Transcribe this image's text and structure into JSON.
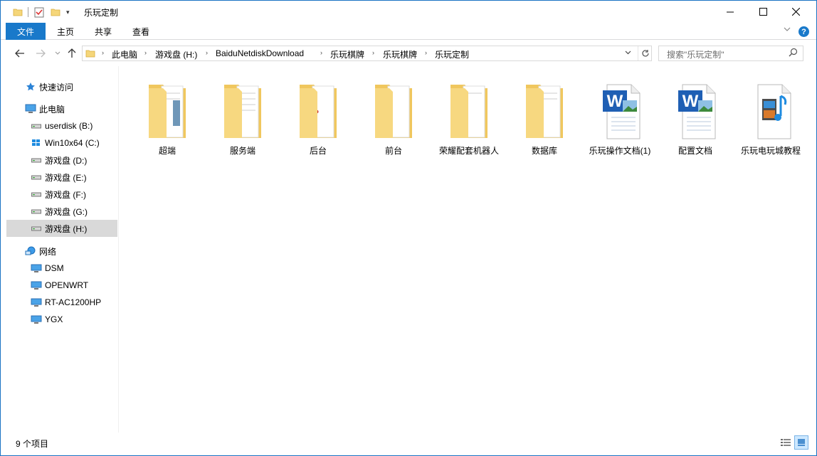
{
  "window": {
    "title": "乐玩定制"
  },
  "ribbon": {
    "tabs": [
      {
        "label": "文件",
        "active": true
      },
      {
        "label": "主页"
      },
      {
        "label": "共享"
      },
      {
        "label": "查看"
      }
    ],
    "help_label": "?"
  },
  "address": {
    "crumbs": [
      "此电脑",
      "游戏盘 (H:)",
      "BaiduNetdiskDownload",
      "乐玩棋牌",
      "乐玩棋牌",
      "乐玩定制"
    ]
  },
  "search": {
    "placeholder": "搜索\"乐玩定制\""
  },
  "sidebar": {
    "items": [
      {
        "label": "快速访问",
        "icon": "star-icon",
        "level": 0
      },
      {
        "label": "此电脑",
        "icon": "pc-icon",
        "level": 0
      },
      {
        "label": "userdisk (B:)",
        "icon": "drive-icon",
        "level": 1
      },
      {
        "label": "Win10x64 (C:)",
        "icon": "windows-drive-icon",
        "level": 1
      },
      {
        "label": "游戏盘 (D:)",
        "icon": "drive-icon",
        "level": 1
      },
      {
        "label": "游戏盘 (E:)",
        "icon": "drive-icon",
        "level": 1
      },
      {
        "label": "游戏盘 (F:)",
        "icon": "drive-icon",
        "level": 1
      },
      {
        "label": "游戏盘 (G:)",
        "icon": "drive-icon",
        "level": 1
      },
      {
        "label": "游戏盘 (H:)",
        "icon": "drive-icon",
        "level": 1,
        "selected": true
      },
      {
        "label": "网络",
        "icon": "network-icon",
        "level": 0
      },
      {
        "label": "DSM",
        "icon": "computer-icon",
        "level": 1
      },
      {
        "label": "OPENWRT",
        "icon": "computer-icon",
        "level": 1
      },
      {
        "label": "RT-AC1200HP",
        "icon": "computer-icon",
        "level": 1
      },
      {
        "label": "YGX",
        "icon": "computer-icon",
        "level": 1
      }
    ]
  },
  "files": [
    {
      "name": "超端",
      "type": "folder",
      "icon": "folder-icon"
    },
    {
      "name": "服务端",
      "type": "folder",
      "icon": "folder-icon"
    },
    {
      "name": "后台",
      "type": "folder",
      "icon": "folder-icon"
    },
    {
      "name": "前台",
      "type": "folder",
      "icon": "folder-icon"
    },
    {
      "name": "荣耀配套机器人",
      "type": "folder",
      "icon": "folder-icon"
    },
    {
      "name": "数据库",
      "type": "folder",
      "icon": "folder-icon"
    },
    {
      "name": "乐玩操作文档(1)",
      "type": "word",
      "icon": "word-doc-icon"
    },
    {
      "name": "配置文档",
      "type": "word",
      "icon": "word-doc-icon"
    },
    {
      "name": "乐玩电玩城教程",
      "type": "video",
      "icon": "video-file-icon"
    }
  ],
  "status": {
    "item_count": "9 个项目"
  },
  "colors": {
    "accent": "#1979ca",
    "folder": "#f5d67a",
    "selection": "#d9d9d9"
  }
}
